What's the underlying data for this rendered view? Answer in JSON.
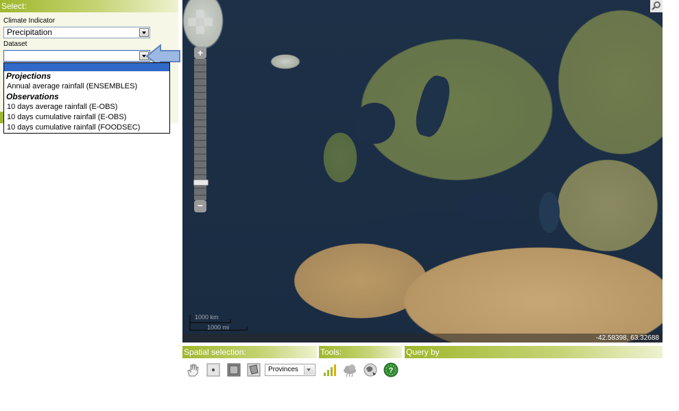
{
  "left_panel": {
    "header": "Select:",
    "climate_indicator_label": "Climate Indicator",
    "climate_indicator_value": "Precipitation",
    "dataset_label": "Dataset",
    "dataset_value": ""
  },
  "dropdown": {
    "groups": [
      {
        "label": "Projections",
        "options": [
          "Annual average rainfall (ENSEMBLES)"
        ]
      },
      {
        "label": "Observations",
        "options": [
          "10 days average rainfall (E-OBS)",
          "10 days cumulative rainfall (E-OBS)",
          "10 days cumulative rainfall (FOODSEC)"
        ]
      }
    ]
  },
  "map": {
    "zoom_in": "+",
    "zoom_out": "−",
    "scale_top": "1000 km",
    "scale_bottom": "1000 mi",
    "coordinates": "-42.58398, 63.32688"
  },
  "bottom": {
    "spatial_header": "Spatial selection:",
    "tools_header": "Tools:",
    "query_header": "Query by",
    "region_select": "Provinces"
  },
  "icons": [
    "pan-hand-icon",
    "point-select-icon",
    "box-select-icon",
    "polygon-select-icon",
    "bar-chart-icon",
    "cloud-icon",
    "globe-icon",
    "help-icon",
    "magnify-icon"
  ],
  "colors": {
    "accent_green": "#9fb72c",
    "selection_blue": "#3169c6",
    "arrow_blue": "#8fb0dd"
  }
}
